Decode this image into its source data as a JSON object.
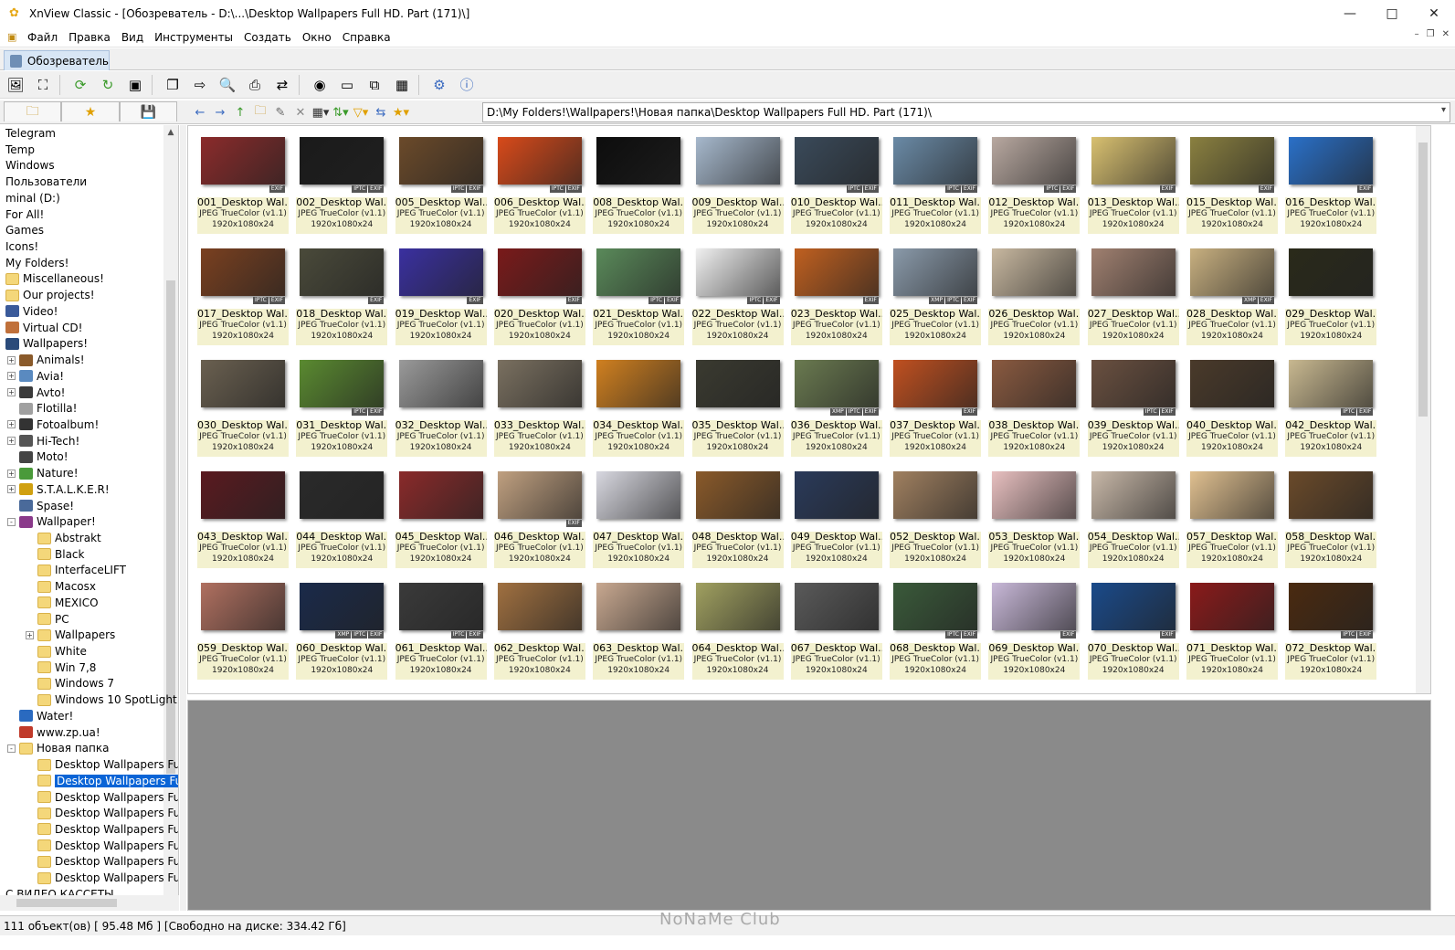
{
  "window": {
    "title": "XnView Classic - [Обозреватель - D:\\...\\Desktop Wallpapers Full HD. Part (171)\\]"
  },
  "menu": [
    "Файл",
    "Правка",
    "Вид",
    "Инструменты",
    "Создать",
    "Окно",
    "Справка"
  ],
  "tab": {
    "label": "Обозреватель"
  },
  "address": {
    "path": "D:\\My Folders!\\Wallpapers!\\Новая папка\\Desktop Wallpapers Full HD. Part (171)\\"
  },
  "colors": {
    "selection": "#0a64d6",
    "info_bg": "#f3f1cf",
    "preview_bg": "#8a8a8a"
  },
  "tree": [
    {
      "label": "Telegram",
      "level": 0,
      "icon": "none"
    },
    {
      "label": "Temp",
      "level": 0,
      "icon": "none"
    },
    {
      "label": "Windows",
      "level": 0,
      "icon": "none"
    },
    {
      "label": "Пользователи",
      "level": 0,
      "icon": "none"
    },
    {
      "label": "minal (D:)",
      "level": 0,
      "icon": "none"
    },
    {
      "label": "For All!",
      "level": 0,
      "icon": "none"
    },
    {
      "label": "Games",
      "level": 0,
      "icon": "none"
    },
    {
      "label": "Icons!",
      "level": 0,
      "icon": "none"
    },
    {
      "label": "My Folders!",
      "level": 0,
      "icon": "none"
    },
    {
      "label": "Miscellaneous!",
      "level": 0,
      "icon": "folder-icon"
    },
    {
      "label": "Our projects!",
      "level": 0,
      "icon": "folder-icon"
    },
    {
      "label": "Video!",
      "level": 0,
      "icon": "video-icon"
    },
    {
      "label": "Virtual CD!",
      "level": 0,
      "icon": "cd-icon"
    },
    {
      "label": "Wallpapers!",
      "level": 0,
      "icon": "monitor-icon"
    },
    {
      "label": "Animals!",
      "level": 1,
      "icon": "animal-icon",
      "exp": "+"
    },
    {
      "label": "Avia!",
      "level": 1,
      "icon": "plane-icon",
      "exp": "+"
    },
    {
      "label": "Avto!",
      "level": 1,
      "icon": "car-icon",
      "exp": "+"
    },
    {
      "label": "Flotilla!",
      "level": 1,
      "icon": "ship-icon"
    },
    {
      "label": "Fotoalbum!",
      "level": 1,
      "icon": "camera-icon",
      "exp": "+"
    },
    {
      "label": "Hi-Tech!",
      "level": 1,
      "icon": "tech-icon",
      "exp": "+"
    },
    {
      "label": "Moto!",
      "level": 1,
      "icon": "moto-icon"
    },
    {
      "label": "Nature!",
      "level": 1,
      "icon": "leaf-icon",
      "exp": "+"
    },
    {
      "label": "S.T.A.L.K.E.R!",
      "level": 1,
      "icon": "radiation-icon",
      "exp": "+"
    },
    {
      "label": "Spase!",
      "level": 1,
      "icon": "planet-icon"
    },
    {
      "label": "Wallpaper!",
      "level": 1,
      "icon": "wallpaper-icon",
      "exp": "-"
    },
    {
      "label": "Abstrakt",
      "level": 2,
      "icon": "folder-icon"
    },
    {
      "label": "Black",
      "level": 2,
      "icon": "folder-icon"
    },
    {
      "label": "InterfaceLIFT",
      "level": 2,
      "icon": "folder-icon"
    },
    {
      "label": "Macosx",
      "level": 2,
      "icon": "folder-icon"
    },
    {
      "label": "MEXICO",
      "level": 2,
      "icon": "folder-icon"
    },
    {
      "label": "PC",
      "level": 2,
      "icon": "folder-icon"
    },
    {
      "label": "Wallpapers",
      "level": 2,
      "icon": "folder-icon",
      "exp": "+"
    },
    {
      "label": "White",
      "level": 2,
      "icon": "folder-icon"
    },
    {
      "label": "Win 7,8",
      "level": 2,
      "icon": "folder-icon"
    },
    {
      "label": "Windows 7",
      "level": 2,
      "icon": "folder-icon"
    },
    {
      "label": "Windows 10 SpotLight",
      "level": 2,
      "icon": "folder-icon"
    },
    {
      "label": "Water!",
      "level": 1,
      "icon": "water-icon"
    },
    {
      "label": "www.zp.ua!",
      "level": 1,
      "icon": "web-icon"
    },
    {
      "label": "Новая папка",
      "level": 1,
      "icon": "folder-icon",
      "exp": "-"
    },
    {
      "label": "Desktop Wallpapers Fu",
      "level": 2,
      "icon": "folder-icon"
    },
    {
      "label": "Desktop Wallpapers Fu",
      "level": 2,
      "icon": "folder-icon",
      "selected": true
    },
    {
      "label": "Desktop Wallpapers Fu",
      "level": 2,
      "icon": "folder-icon"
    },
    {
      "label": "Desktop Wallpapers Fu",
      "level": 2,
      "icon": "folder-icon"
    },
    {
      "label": "Desktop Wallpapers Fu",
      "level": 2,
      "icon": "folder-icon"
    },
    {
      "label": "Desktop Wallpapers Fu",
      "level": 2,
      "icon": "folder-icon"
    },
    {
      "label": "Desktop Wallpapers Fu",
      "level": 2,
      "icon": "folder-icon"
    },
    {
      "label": "Desktop Wallpapers Fu",
      "level": 2,
      "icon": "folder-icon"
    },
    {
      "label": "С ВИДЕО КАССЕТЫ",
      "level": 0,
      "icon": "none"
    }
  ],
  "thumbnails": [
    {
      "name": "001_Desktop Wal...",
      "type": "JPEG TrueColor (v1.1)",
      "dims": "1920x1080x24",
      "badges": [
        "EXIF"
      ],
      "color": "#8b2b2b"
    },
    {
      "name": "002_Desktop Wal...",
      "type": "JPEG TrueColor (v1.1)",
      "dims": "1920x1080x24",
      "badges": [
        "IPTC",
        "EXIF"
      ],
      "color": "#1a1a1a"
    },
    {
      "name": "005_Desktop Wal...",
      "type": "JPEG TrueColor (v1.1)",
      "dims": "1920x1080x24",
      "badges": [
        "IPTC",
        "EXIF"
      ],
      "color": "#6b4a2a"
    },
    {
      "name": "006_Desktop Wal...",
      "type": "JPEG TrueColor (v1.1)",
      "dims": "1920x1080x24",
      "badges": [
        "IPTC",
        "EXIF"
      ],
      "color": "#d84a1a"
    },
    {
      "name": "008_Desktop Wal...",
      "type": "JPEG TrueColor (v1.1)",
      "dims": "1920x1080x24",
      "badges": [],
      "color": "#0d0d0d"
    },
    {
      "name": "009_Desktop Wal...",
      "type": "JPEG TrueColor (v1.1)",
      "dims": "1920x1080x24",
      "badges": [],
      "color": "#a6b8cc"
    },
    {
      "name": "010_Desktop Wal...",
      "type": "JPEG TrueColor (v1.1)",
      "dims": "1920x1080x24",
      "badges": [
        "IPTC",
        "EXIF"
      ],
      "color": "#3a4a5a"
    },
    {
      "name": "011_Desktop Wal...",
      "type": "JPEG TrueColor (v1.1)",
      "dims": "1920x1080x24",
      "badges": [
        "IPTC",
        "EXIF"
      ],
      "color": "#6a8aa6"
    },
    {
      "name": "012_Desktop Wal...",
      "type": "JPEG TrueColor (v1.1)",
      "dims": "1920x1080x24",
      "badges": [
        "IPTC",
        "EXIF"
      ],
      "color": "#b8a8a0"
    },
    {
      "name": "013_Desktop Wal...",
      "type": "JPEG TrueColor (v1.1)",
      "dims": "1920x1080x24",
      "badges": [
        "EXIF"
      ],
      "color": "#d8c070"
    },
    {
      "name": "015_Desktop Wal...",
      "type": "JPEG TrueColor (v1.1)",
      "dims": "1920x1080x24",
      "badges": [
        "EXIF"
      ],
      "color": "#8a8040"
    },
    {
      "name": "016_Desktop Wal...",
      "type": "JPEG TrueColor (v1.1)",
      "dims": "1920x1080x24",
      "badges": [
        "EXIF"
      ],
      "color": "#2a70c8"
    },
    {
      "name": "017_Desktop Wal...",
      "type": "JPEG TrueColor (v1.1)",
      "dims": "1920x1080x24",
      "badges": [
        "IPTC",
        "EXIF"
      ],
      "color": "#7a4020"
    },
    {
      "name": "018_Desktop Wal...",
      "type": "JPEG TrueColor (v1.1)",
      "dims": "1920x1080x24",
      "badges": [
        "EXIF"
      ],
      "color": "#4a4a3a"
    },
    {
      "name": "019_Desktop Wal...",
      "type": "JPEG TrueColor (v1.1)",
      "dims": "1920x1080x24",
      "badges": [
        "EXIF"
      ],
      "color": "#3a30a0"
    },
    {
      "name": "020_Desktop Wal...",
      "type": "JPEG TrueColor (v1.1)",
      "dims": "1920x1080x24",
      "badges": [
        "EXIF"
      ],
      "color": "#7a1a1a"
    },
    {
      "name": "021_Desktop Wal...",
      "type": "JPEG TrueColor (v1.1)",
      "dims": "1920x1080x24",
      "badges": [
        "IPTC",
        "EXIF"
      ],
      "color": "#5a8a5a"
    },
    {
      "name": "022_Desktop Wal...",
      "type": "JPEG TrueColor (v1.1)",
      "dims": "1920x1080x24",
      "badges": [
        "IPTC",
        "EXIF"
      ],
      "color": "#f0f0f0"
    },
    {
      "name": "023_Desktop Wal...",
      "type": "JPEG TrueColor (v1.1)",
      "dims": "1920x1080x24",
      "badges": [
        "EXIF"
      ],
      "color": "#c06020"
    },
    {
      "name": "025_Desktop Wal...",
      "type": "JPEG TrueColor (v1.1)",
      "dims": "1920x1080x24",
      "badges": [
        "XMP",
        "IPTC",
        "EXIF"
      ],
      "color": "#8a9aaa"
    },
    {
      "name": "026_Desktop Wal...",
      "type": "JPEG TrueColor (v1.1)",
      "dims": "1920x1080x24",
      "badges": [],
      "color": "#c8b8a0"
    },
    {
      "name": "027_Desktop Wal...",
      "type": "JPEG TrueColor (v1.1)",
      "dims": "1920x1080x24",
      "badges": [],
      "color": "#a08070"
    },
    {
      "name": "028_Desktop Wal...",
      "type": "JPEG TrueColor (v1.1)",
      "dims": "1920x1080x24",
      "badges": [
        "XMP",
        "EXIF"
      ],
      "color": "#c8b080"
    },
    {
      "name": "029_Desktop Wal...",
      "type": "JPEG TrueColor (v1.1)",
      "dims": "1920x1080x24",
      "badges": [],
      "color": "#2a2a1a"
    },
    {
      "name": "030_Desktop Wal...",
      "type": "JPEG TrueColor (v1.1)",
      "dims": "1920x1080x24",
      "badges": [],
      "color": "#6a6050"
    },
    {
      "name": "031_Desktop Wal...",
      "type": "JPEG TrueColor (v1.1)",
      "dims": "1920x1080x24",
      "badges": [
        "IPTC",
        "EXIF"
      ],
      "color": "#5a8a30"
    },
    {
      "name": "032_Desktop Wal...",
      "type": "JPEG TrueColor (v1.1)",
      "dims": "1920x1080x24",
      "badges": [],
      "color": "#9a9a9a"
    },
    {
      "name": "033_Desktop Wal...",
      "type": "JPEG TrueColor (v1.1)",
      "dims": "1920x1080x24",
      "badges": [],
      "color": "#7a7060"
    },
    {
      "name": "034_Desktop Wal...",
      "type": "JPEG TrueColor (v1.1)",
      "dims": "1920x1080x24",
      "badges": [],
      "color": "#d08020"
    },
    {
      "name": "035_Desktop Wal...",
      "type": "JPEG TrueColor (v1.1)",
      "dims": "1920x1080x24",
      "badges": [],
      "color": "#3a3a30"
    },
    {
      "name": "036_Desktop Wal...",
      "type": "JPEG TrueColor (v1.1)",
      "dims": "1920x1080x24",
      "badges": [
        "XMP",
        "IPTC",
        "EXIF"
      ],
      "color": "#6a7a50"
    },
    {
      "name": "037_Desktop Wal...",
      "type": "JPEG TrueColor (v1.1)",
      "dims": "1920x1080x24",
      "badges": [
        "EXIF"
      ],
      "color": "#c05020"
    },
    {
      "name": "038_Desktop Wal...",
      "type": "JPEG TrueColor (v1.1)",
      "dims": "1920x1080x24",
      "badges": [],
      "color": "#8a5a40"
    },
    {
      "name": "039_Desktop Wal...",
      "type": "JPEG TrueColor (v1.1)",
      "dims": "1920x1080x24",
      "badges": [
        "IPTC",
        "EXIF"
      ],
      "color": "#6a5040"
    },
    {
      "name": "040_Desktop Wal...",
      "type": "JPEG TrueColor (v1.1)",
      "dims": "1920x1080x24",
      "badges": [],
      "color": "#4a3a2a"
    },
    {
      "name": "042_Desktop Wal...",
      "type": "JPEG TrueColor (v1.1)",
      "dims": "1920x1080x24",
      "badges": [
        "IPTC",
        "EXIF"
      ],
      "color": "#c8b890"
    },
    {
      "name": "043_Desktop Wal...",
      "type": "JPEG TrueColor (v1.1)",
      "dims": "1920x1080x24",
      "badges": [],
      "color": "#5a1a20"
    },
    {
      "name": "044_Desktop Wal...",
      "type": "JPEG TrueColor (v1.1)",
      "dims": "1920x1080x24",
      "badges": [],
      "color": "#2a2a2a"
    },
    {
      "name": "045_Desktop Wal...",
      "type": "JPEG TrueColor (v1.1)",
      "dims": "1920x1080x24",
      "badges": [],
      "color": "#8a2a2a"
    },
    {
      "name": "046_Desktop Wal...",
      "type": "JPEG TrueColor (v1.1)",
      "dims": "1920x1080x24",
      "badges": [
        "EXIF"
      ],
      "color": "#c0a080"
    },
    {
      "name": "047_Desktop Wal...",
      "type": "JPEG TrueColor (v1.1)",
      "dims": "1920x1080x24",
      "badges": [],
      "color": "#d8d8e0"
    },
    {
      "name": "048_Desktop Wal...",
      "type": "JPEG TrueColor (v1.1)",
      "dims": "1920x1080x24",
      "badges": [],
      "color": "#8a5a2a"
    },
    {
      "name": "049_Desktop Wal...",
      "type": "JPEG TrueColor (v1.1)",
      "dims": "1920x1080x24",
      "badges": [],
      "color": "#2a3a5a"
    },
    {
      "name": "052_Desktop Wal...",
      "type": "JPEG TrueColor (v1.1)",
      "dims": "1920x1080x24",
      "badges": [],
      "color": "#a08060"
    },
    {
      "name": "053_Desktop Wal...",
      "type": "JPEG TrueColor (v1.1)",
      "dims": "1920x1080x24",
      "badges": [],
      "color": "#e8c0c0"
    },
    {
      "name": "054_Desktop Wal...",
      "type": "JPEG TrueColor (v1.1)",
      "dims": "1920x1080x24",
      "badges": [],
      "color": "#c8b8a8"
    },
    {
      "name": "057_Desktop Wal...",
      "type": "JPEG TrueColor (v1.1)",
      "dims": "1920x1080x24",
      "badges": [],
      "color": "#e0c090"
    },
    {
      "name": "058_Desktop Wal...",
      "type": "JPEG TrueColor (v1.1)",
      "dims": "1920x1080x24",
      "badges": [],
      "color": "#6a4a2a"
    },
    {
      "name": "059_Desktop Wal...",
      "type": "JPEG TrueColor (v1.1)",
      "dims": "1920x1080x24",
      "badges": [],
      "color": "#b07060"
    },
    {
      "name": "060_Desktop Wal...",
      "type": "JPEG TrueColor (v1.1)",
      "dims": "1920x1080x24",
      "badges": [
        "XMP",
        "IPTC",
        "EXIF"
      ],
      "color": "#1a2a4a"
    },
    {
      "name": "061_Desktop Wal...",
      "type": "JPEG TrueColor (v1.1)",
      "dims": "1920x1080x24",
      "badges": [
        "IPTC",
        "EXIF"
      ],
      "color": "#3a3a3a"
    },
    {
      "name": "062_Desktop Wal...",
      "type": "JPEG TrueColor (v1.1)",
      "dims": "1920x1080x24",
      "badges": [],
      "color": "#a07040"
    },
    {
      "name": "063_Desktop Wal...",
      "type": "JPEG TrueColor (v1.1)",
      "dims": "1920x1080x24",
      "badges": [],
      "color": "#c8a890"
    },
    {
      "name": "064_Desktop Wal...",
      "type": "JPEG TrueColor (v1.1)",
      "dims": "1920x1080x24",
      "badges": [],
      "color": "#a0a060"
    },
    {
      "name": "067_Desktop Wal...",
      "type": "JPEG TrueColor (v1.1)",
      "dims": "1920x1080x24",
      "badges": [],
      "color": "#5a5a5a"
    },
    {
      "name": "068_Desktop Wal...",
      "type": "JPEG TrueColor (v1.1)",
      "dims": "1920x1080x24",
      "badges": [
        "IPTC",
        "EXIF"
      ],
      "color": "#3a5a3a"
    },
    {
      "name": "069_Desktop Wal...",
      "type": "JPEG TrueColor (v1.1)",
      "dims": "1920x1080x24",
      "badges": [
        "EXIF"
      ],
      "color": "#c8b8d8"
    },
    {
      "name": "070_Desktop Wal...",
      "type": "JPEG TrueColor (v1.1)",
      "dims": "1920x1080x24",
      "badges": [
        "EXIF"
      ],
      "color": "#1a4a8a"
    },
    {
      "name": "071_Desktop Wal...",
      "type": "JPEG TrueColor (v1.1)",
      "dims": "1920x1080x24",
      "badges": [],
      "color": "#8a1a1a"
    },
    {
      "name": "072_Desktop Wal...",
      "type": "JPEG TrueColor (v1.1)",
      "dims": "1920x1080x24",
      "badges": [
        "IPTC",
        "EXIF"
      ],
      "color": "#4a2a10"
    }
  ],
  "status": {
    "text": "111 объект(ов) [ 95.48 Мб ] [Свободно на диске: 334.42 Гб]"
  },
  "watermark": "NoNaMe Club"
}
